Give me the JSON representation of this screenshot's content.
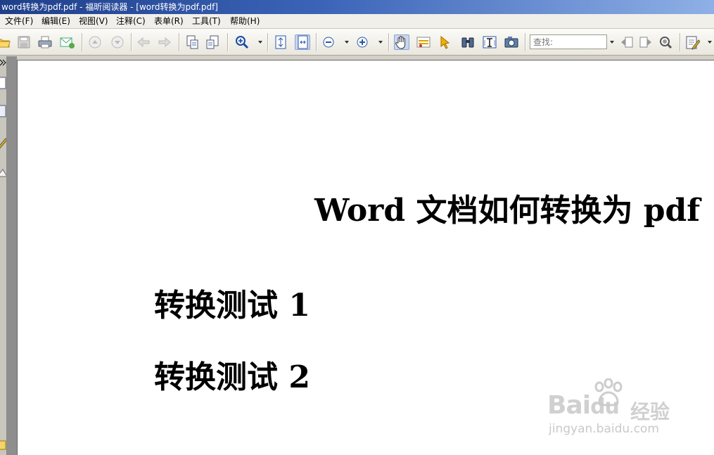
{
  "window": {
    "title": "word转换为pdf.pdf - 福昕阅读器 - [word转换为pdf.pdf]"
  },
  "menu": [
    {
      "label": "文件(F)"
    },
    {
      "label": "编辑(E)"
    },
    {
      "label": "视图(V)"
    },
    {
      "label": "注释(C)"
    },
    {
      "label": "表单(R)"
    },
    {
      "label": "工具(T)"
    },
    {
      "label": "帮助(H)"
    }
  ],
  "toolbar": {
    "icons": [
      "open-icon",
      "save-icon",
      "print-icon",
      "email-icon",
      "first-page-icon",
      "prev-page-icon",
      "back-icon",
      "forward-icon",
      "extract-page-icon",
      "insert-page-icon",
      "zoom-in-icon",
      "fit-page-icon",
      "fit-width-icon",
      "zoom-out-icon",
      "zoom-plus-icon",
      "hand-tool-icon",
      "select-text-icon",
      "pointer-icon",
      "find-icon",
      "typewriter-icon",
      "snapshot-icon",
      "search-prev-icon",
      "search-next-icon",
      "advanced-search-icon",
      "annotation-icon"
    ],
    "search_placeholder": "查找:",
    "active_tool": "hand-tool"
  },
  "document": {
    "title": "Word 文档如何转换为 pdf",
    "headings": [
      "转换测试 1",
      "转换测试 2"
    ]
  },
  "watermark": {
    "logo_text": "Bai",
    "logo_text2": "du",
    "cn_text": "经验",
    "url": "jingyan.baidu.com"
  },
  "colors": {
    "titlebar_start": "#1f3f8a",
    "titlebar_end": "#8fb0e6",
    "toolbar_bg": "#e9e7dd",
    "active_tool_bg": "#c8d6ef",
    "page_bg": "#ffffff"
  }
}
